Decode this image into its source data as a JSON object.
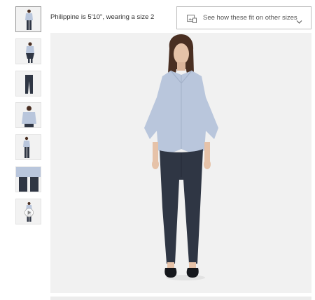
{
  "fit_info": {
    "model_text": "Philippine is 5'10\", wearing a size 2"
  },
  "fit_button": {
    "label": "See how these fit on other sizes",
    "icon": "ruler-image-icon",
    "chevron": "chevron-down-icon"
  },
  "gallery": {
    "thumbnail_count": 7,
    "selected_index": 0,
    "video_thumbnail_index": 6
  },
  "colors": {
    "shirt": "#b9c6dc",
    "pants": "#2f3644",
    "hair": "#4a2f22",
    "background": "#f1f1f1",
    "border": "#bdbdbd"
  }
}
